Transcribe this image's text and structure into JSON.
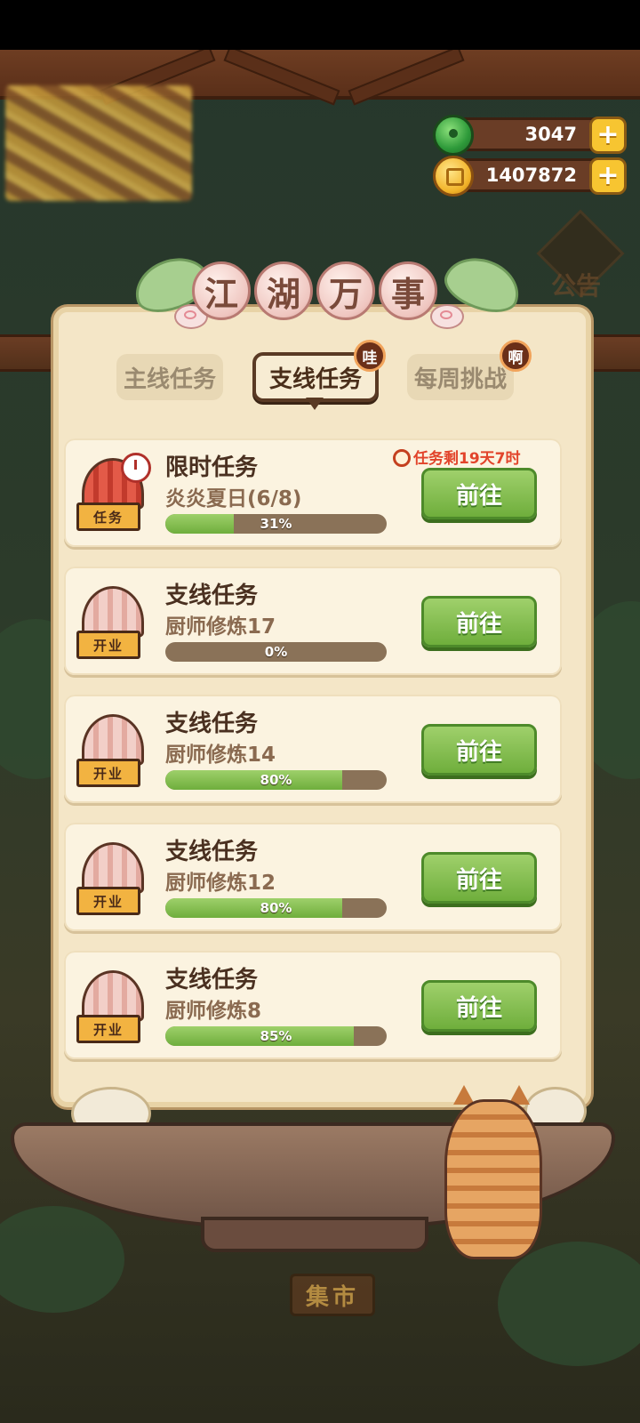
{
  "header": {
    "jade_amount": "3047",
    "coin_amount": "1407872",
    "plus_label": "+"
  },
  "notice": {
    "label": "公告"
  },
  "panel": {
    "title_chars": [
      "江",
      "湖",
      "万",
      "事"
    ]
  },
  "tabs": [
    {
      "label": "主线任务",
      "active": false,
      "badge": ""
    },
    {
      "label": "支线任务",
      "active": true,
      "badge": "哇"
    },
    {
      "label": "每周挑战",
      "active": false,
      "badge": "啊"
    }
  ],
  "tasks": [
    {
      "icon": "limited-task-hut-icon",
      "icon_sign": "任务",
      "kind": "限时任务",
      "name": "炎炎夏日(6/8)",
      "progress": 0.31,
      "progress_label": "31%",
      "button": "前往",
      "timer": "任务剩19天7时"
    },
    {
      "icon": "business-hut-icon",
      "icon_sign": "开业",
      "kind": "支线任务",
      "name": "厨师修炼17",
      "progress": 0.0,
      "progress_label": "0%",
      "button": "前往",
      "timer": ""
    },
    {
      "icon": "business-hut-icon",
      "icon_sign": "开业",
      "kind": "支线任务",
      "name": "厨师修炼14",
      "progress": 0.8,
      "progress_label": "80%",
      "button": "前往",
      "timer": ""
    },
    {
      "icon": "business-hut-icon",
      "icon_sign": "开业",
      "kind": "支线任务",
      "name": "厨师修炼12",
      "progress": 0.8,
      "progress_label": "80%",
      "button": "前往",
      "timer": ""
    },
    {
      "icon": "business-hut-icon",
      "icon_sign": "开业",
      "kind": "支线任务",
      "name": "厨师修炼8",
      "progress": 0.85,
      "progress_label": "85%",
      "button": "前往",
      "timer": ""
    }
  ],
  "bottom": {
    "market_label": "集市"
  },
  "colors": {
    "accent_green": "#6fae3c",
    "timer_red": "#e2442b",
    "panel_bg": "#f4e6c7"
  }
}
